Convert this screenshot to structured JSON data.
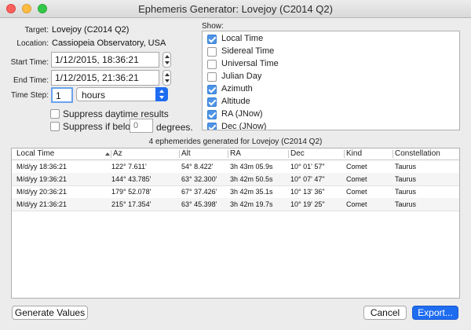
{
  "window": {
    "title": "Ephemeris Generator: Lovejoy (C2014 Q2)"
  },
  "form": {
    "target_label": "Target:",
    "target_value": "Lovejoy (C2014 Q2)",
    "location_label": "Location:",
    "location_value": "Cassiopeia Observatory, USA",
    "start_label": "Start Time:",
    "start_value": "1/12/2015, 18:36:21",
    "end_label": "End Time:",
    "end_value": "1/12/2015, 21:36:21",
    "step_label": "Time Step:",
    "step_value": "1",
    "step_unit": "hours",
    "suppress_daytime_label": "Suppress daytime results",
    "suppress_daytime_checked": false,
    "suppress_below_label": "Suppress if below",
    "suppress_below_checked": false,
    "suppress_below_placeholder": "0",
    "suppress_below_unit": "degrees."
  },
  "show": {
    "label": "Show:",
    "items": [
      {
        "label": "Local Time",
        "checked": true
      },
      {
        "label": "Sidereal Time",
        "checked": false
      },
      {
        "label": "Universal Time",
        "checked": false
      },
      {
        "label": "Julian Day",
        "checked": false
      },
      {
        "label": "Azimuth",
        "checked": true
      },
      {
        "label": "Altitude",
        "checked": true
      },
      {
        "label": "RA (JNow)",
        "checked": true
      },
      {
        "label": "Dec (JNow)",
        "checked": true
      }
    ]
  },
  "results": {
    "status": "4 ephemerides generated for Lovejoy (C2014 Q2)",
    "columns": [
      "Local Time",
      "Az",
      "Alt",
      "RA",
      "Dec",
      "Kind",
      "Constellation"
    ],
    "rows": [
      [
        "M/d/yy 18:36:21",
        "122° 7.611'",
        "54° 8.422'",
        "3h 43m 05.9s",
        "10° 01' 57\"",
        "Comet",
        "Taurus"
      ],
      [
        "M/d/yy 19:36:21",
        "144° 43.785'",
        "63° 32.300'",
        "3h 42m 50.5s",
        "10° 07' 47\"",
        "Comet",
        "Taurus"
      ],
      [
        "M/d/yy 20:36:21",
        "179° 52.078'",
        "67° 37.426'",
        "3h 42m 35.1s",
        "10° 13' 36\"",
        "Comet",
        "Taurus"
      ],
      [
        "M/d/yy 21:36:21",
        "215° 17.354'",
        "63° 45.398'",
        "3h 42m 19.7s",
        "10° 19' 25\"",
        "Comet",
        "Taurus"
      ]
    ]
  },
  "buttons": {
    "generate": "Generate Values",
    "cancel": "Cancel",
    "export": "Export..."
  },
  "colors": {
    "accent": "#1e6cf0",
    "checkbox_on": "#4d94e8"
  }
}
